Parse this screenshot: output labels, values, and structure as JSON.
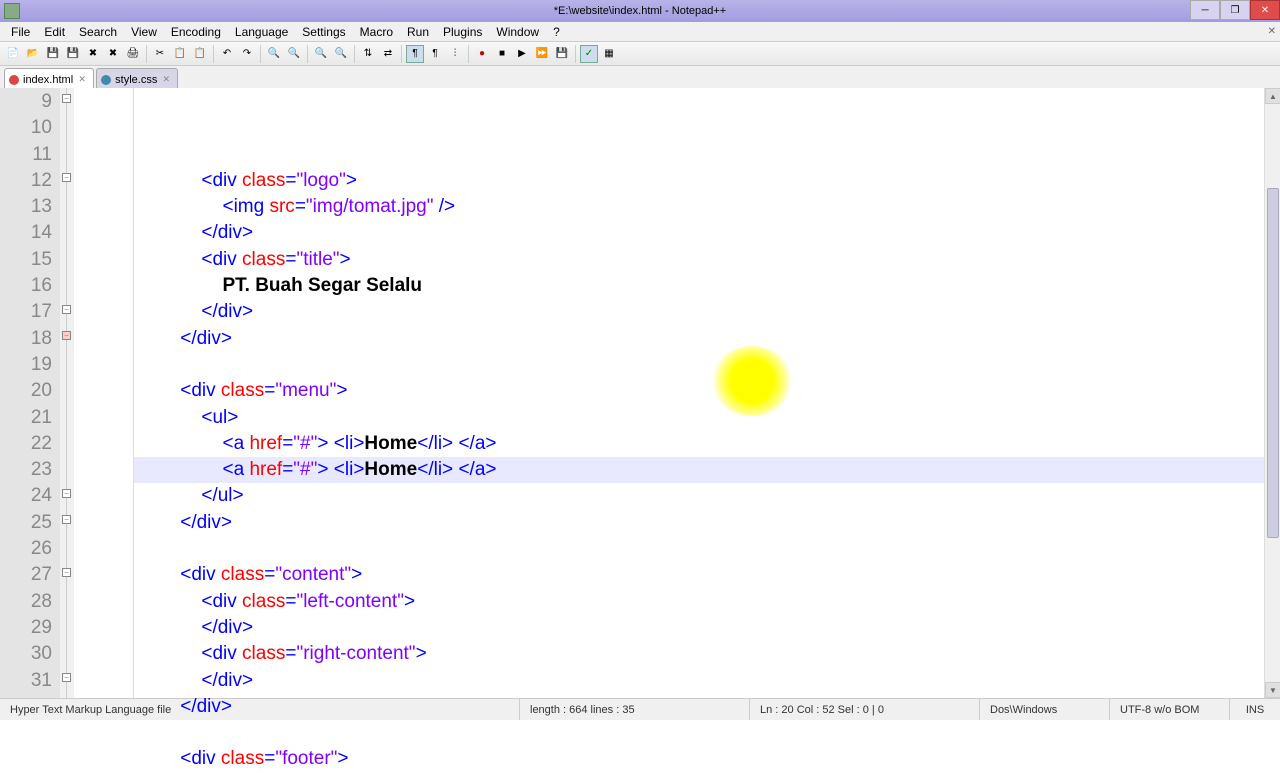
{
  "window": {
    "title": "*E:\\website\\index.html - Notepad++"
  },
  "menubar": {
    "file": "File",
    "edit": "Edit",
    "search": "Search",
    "view": "View",
    "encoding": "Encoding",
    "language": "Language",
    "settings": "Settings",
    "macro": "Macro",
    "run": "Run",
    "plugins": "Plugins",
    "window": "Window",
    "help": "?"
  },
  "tabs": {
    "tab1": "index.html",
    "tab2": "style.css"
  },
  "gutter": {
    "start": 9,
    "end": 31
  },
  "code": {
    "lines": [
      {
        "indent": 3,
        "tokens": [
          [
            "br",
            "<"
          ],
          [
            "kw1",
            "div"
          ],
          [
            "txt",
            " "
          ],
          [
            "attr",
            "class"
          ],
          [
            "br",
            "="
          ],
          [
            "str",
            "\"logo\""
          ],
          [
            "br",
            ">"
          ]
        ]
      },
      {
        "indent": 4,
        "tokens": [
          [
            "br",
            "<"
          ],
          [
            "kw1",
            "img"
          ],
          [
            "txt",
            " "
          ],
          [
            "attr",
            "src"
          ],
          [
            "br",
            "="
          ],
          [
            "str",
            "\"img/tomat.jpg\""
          ],
          [
            "txt",
            " "
          ],
          [
            "br",
            "/>"
          ]
        ]
      },
      {
        "indent": 3,
        "tokens": [
          [
            "br",
            "</"
          ],
          [
            "kw1",
            "div"
          ],
          [
            "br",
            ">"
          ]
        ]
      },
      {
        "indent": 3,
        "tokens": [
          [
            "br",
            "<"
          ],
          [
            "kw1",
            "div"
          ],
          [
            "txt",
            " "
          ],
          [
            "attr",
            "class"
          ],
          [
            "br",
            "="
          ],
          [
            "str",
            "\"title\""
          ],
          [
            "br",
            ">"
          ]
        ]
      },
      {
        "indent": 4,
        "tokens": [
          [
            "txt",
            "PT. Buah Segar Selalu"
          ]
        ]
      },
      {
        "indent": 3,
        "tokens": [
          [
            "br",
            "</"
          ],
          [
            "kw1",
            "div"
          ],
          [
            "br",
            ">"
          ]
        ]
      },
      {
        "indent": 2,
        "tokens": [
          [
            "br",
            "</"
          ],
          [
            "kw1",
            "div"
          ],
          [
            "br",
            ">"
          ]
        ]
      },
      {
        "indent": 2,
        "tokens": []
      },
      {
        "indent": 2,
        "tokens": [
          [
            "br",
            "<"
          ],
          [
            "kw1",
            "div"
          ],
          [
            "txt",
            " "
          ],
          [
            "attr",
            "class"
          ],
          [
            "br",
            "="
          ],
          [
            "str",
            "\"menu\""
          ],
          [
            "br",
            ">"
          ]
        ]
      },
      {
        "indent": 3,
        "tokens": [
          [
            "br",
            "<"
          ],
          [
            "kw1",
            "ul"
          ],
          [
            "br",
            ">"
          ]
        ]
      },
      {
        "indent": 4,
        "tokens": [
          [
            "br",
            "<"
          ],
          [
            "kw1",
            "a"
          ],
          [
            "txt",
            " "
          ],
          [
            "attr",
            "href"
          ],
          [
            "br",
            "="
          ],
          [
            "str",
            "\"#\""
          ],
          [
            "br",
            ">"
          ],
          [
            "txt",
            " "
          ],
          [
            "br",
            "<"
          ],
          [
            "kw1",
            "li"
          ],
          [
            "br",
            ">"
          ],
          [
            "txt",
            "Home"
          ],
          [
            "br",
            "</"
          ],
          [
            "kw1",
            "li"
          ],
          [
            "br",
            ">"
          ],
          [
            "txt",
            " "
          ],
          [
            "br",
            "</"
          ],
          [
            "kw1",
            "a"
          ],
          [
            "br",
            ">"
          ]
        ]
      },
      {
        "indent": 4,
        "hl": true,
        "tokens": [
          [
            "br",
            "<"
          ],
          [
            "kw1",
            "a"
          ],
          [
            "txt",
            " "
          ],
          [
            "attr",
            "href"
          ],
          [
            "br",
            "="
          ],
          [
            "str",
            "\"#\""
          ],
          [
            "br",
            ">"
          ],
          [
            "txt",
            " "
          ],
          [
            "br",
            "<"
          ],
          [
            "kw1",
            "li"
          ],
          [
            "br",
            ">"
          ],
          [
            "txt",
            "Home"
          ],
          [
            "br",
            "</"
          ],
          [
            "kw1",
            "li"
          ],
          [
            "br",
            ">"
          ],
          [
            "txt",
            " "
          ],
          [
            "br",
            "</"
          ],
          [
            "kw1",
            "a"
          ],
          [
            "br",
            ">"
          ]
        ]
      },
      {
        "indent": 3,
        "tokens": [
          [
            "br",
            "</"
          ],
          [
            "kw1",
            "ul"
          ],
          [
            "br",
            ">"
          ]
        ]
      },
      {
        "indent": 2,
        "tokens": [
          [
            "br",
            "</"
          ],
          [
            "kw1",
            "div"
          ],
          [
            "br",
            ">"
          ]
        ]
      },
      {
        "indent": 2,
        "tokens": []
      },
      {
        "indent": 2,
        "tokens": [
          [
            "br",
            "<"
          ],
          [
            "kw1",
            "div"
          ],
          [
            "txt",
            " "
          ],
          [
            "attr",
            "class"
          ],
          [
            "br",
            "="
          ],
          [
            "str",
            "\"content\""
          ],
          [
            "br",
            ">"
          ]
        ]
      },
      {
        "indent": 3,
        "tokens": [
          [
            "br",
            "<"
          ],
          [
            "kw1",
            "div"
          ],
          [
            "txt",
            " "
          ],
          [
            "attr",
            "class"
          ],
          [
            "br",
            "="
          ],
          [
            "str",
            "\"left-content\""
          ],
          [
            "br",
            ">"
          ]
        ]
      },
      {
        "indent": 3,
        "tokens": [
          [
            "br",
            "</"
          ],
          [
            "kw1",
            "div"
          ],
          [
            "br",
            ">"
          ]
        ]
      },
      {
        "indent": 3,
        "tokens": [
          [
            "br",
            "<"
          ],
          [
            "kw1",
            "div"
          ],
          [
            "txt",
            " "
          ],
          [
            "attr",
            "class"
          ],
          [
            "br",
            "="
          ],
          [
            "str",
            "\"right-content\""
          ],
          [
            "br",
            ">"
          ]
        ]
      },
      {
        "indent": 3,
        "tokens": [
          [
            "br",
            "</"
          ],
          [
            "kw1",
            "div"
          ],
          [
            "br",
            ">"
          ]
        ]
      },
      {
        "indent": 2,
        "tokens": [
          [
            "br",
            "</"
          ],
          [
            "kw1",
            "div"
          ],
          [
            "br",
            ">"
          ]
        ]
      },
      {
        "indent": 2,
        "tokens": []
      },
      {
        "indent": 2,
        "tokens": [
          [
            "br",
            "<"
          ],
          [
            "kw1",
            "div"
          ],
          [
            "txt",
            " "
          ],
          [
            "attr",
            "class"
          ],
          [
            "br",
            "="
          ],
          [
            "str",
            "\"footer\""
          ],
          [
            "br",
            ">"
          ]
        ]
      }
    ]
  },
  "status": {
    "filetype": "Hyper Text Markup Language file",
    "length": "length : 664    lines : 35",
    "pos": "Ln : 20    Col : 52    Sel : 0 | 0",
    "eol": "Dos\\Windows",
    "enc": "UTF-8 w/o BOM",
    "mode": "INS"
  }
}
